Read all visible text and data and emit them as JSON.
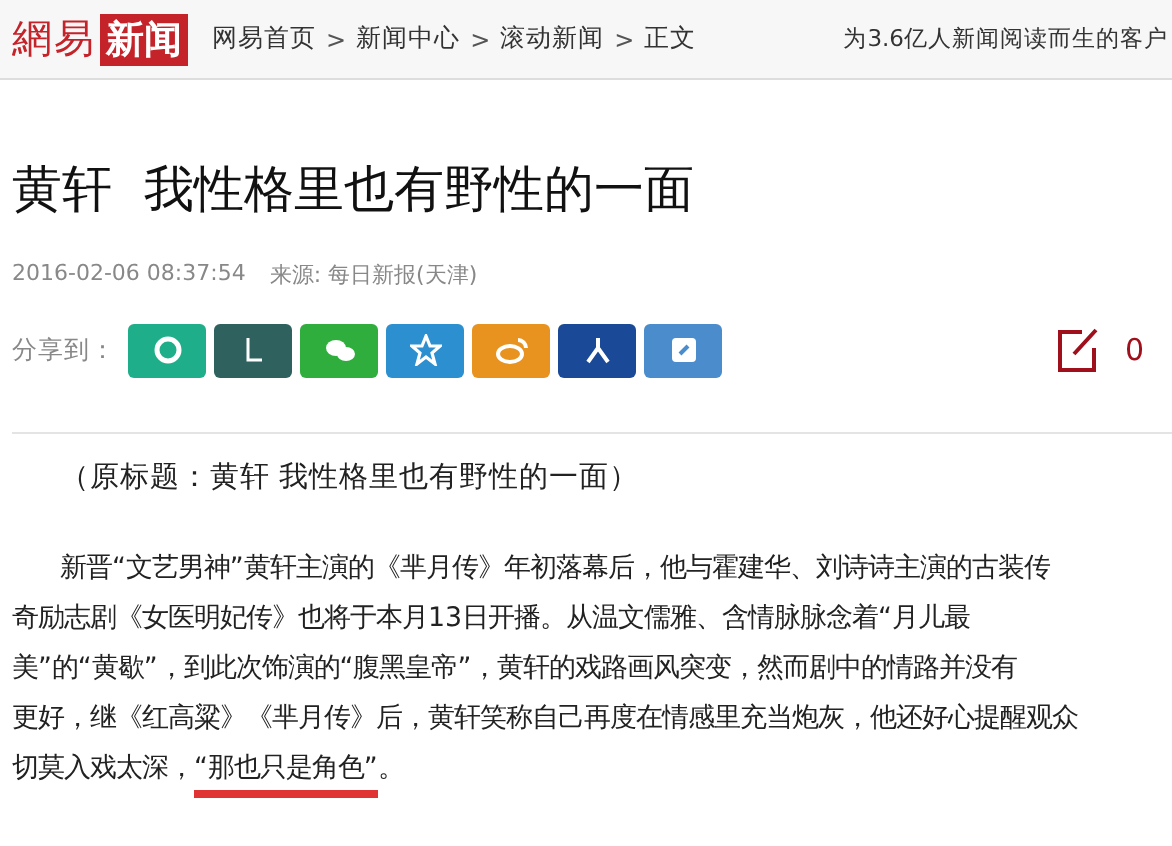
{
  "header": {
    "logo": {
      "text": "網易",
      "badge": "新闻"
    },
    "breadcrumb": [
      "网易首页",
      "新闻中心",
      "滚动新闻",
      "正文"
    ],
    "separator": ">",
    "slogan": "为3.6亿人新闻阅读而生的客户"
  },
  "article": {
    "title": "黄轩  我性格里也有野性的一面",
    "date": "2016-02-06 08:37:54",
    "source": "来源: 每日新报(天津)",
    "share": {
      "label": "分享到：",
      "buttons": [
        {
          "color": "#1fae8a"
        },
        {
          "color": "#2f625e"
        },
        {
          "color": "#2fae3d"
        },
        {
          "color": "#2b8fd0"
        },
        {
          "color": "#e8921f"
        },
        {
          "color": "#1a4a97"
        },
        {
          "color": "#4a8ccc"
        }
      ],
      "comment_count": "0"
    },
    "original_title": "（原标题：黄轩 我性格里也有野性的一面）",
    "paragraph": {
      "lines": [
        "新晋“文艺男神”黄轩主演的《芈月传》年初落幕后，他与霍建华、刘诗诗主演的古装传",
        "奇励志剧《女医明妃传》也将于本月13日开播。从温文儒雅、含情脉脉念着“月儿最",
        "美”的“黄歇”，到此次饰演的“腹黑皇帝”，黄轩的戏路画风突变，然而剧中的情路并没有",
        "更好，继《红高粱》《芈月传》后，黄轩笑称自己再度在情感里充当炮灰，他还好心提醒观众"
      ],
      "last_line": {
        "before": "切莫入戏太深，",
        "highlight": "“那也只是角色”",
        "after": "。"
      }
    }
  }
}
